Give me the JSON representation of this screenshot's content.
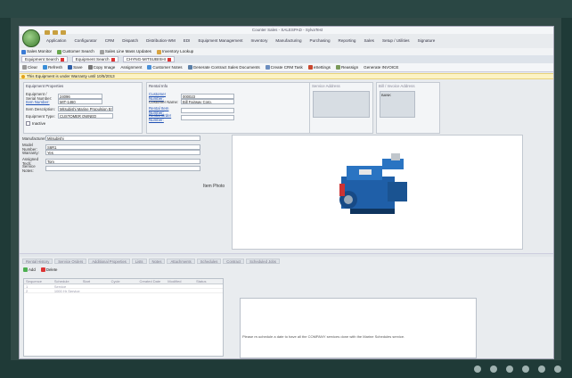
{
  "window": {
    "title": "Counter Sales - SALESPAD - SylvaTest"
  },
  "menu": [
    "Application",
    "Configurator",
    "CRM",
    "Dispatch",
    "Distribution-WM",
    "EDI",
    "Equipment Management",
    "Inventory",
    "Manufacturing",
    "Purchasing",
    "Reporting",
    "Sales",
    "Setup / Utilities",
    "Signature"
  ],
  "toolbar1": [
    "Sales Monitor",
    "Customer Search",
    "Sales Line Mass Updates",
    "Inventory Lookup"
  ],
  "doc_tabs": [
    "Equipment Search",
    "Equipment Search",
    "CHYNG-MITSUBISHI"
  ],
  "toolbar3": [
    "Clear",
    "Refresh",
    "Save",
    "Copy Image",
    "Assignment",
    "Customer Notes",
    "Generate Contract Sales Documents",
    "Create CRM Task",
    "eSettings",
    "Reassign",
    "Generate INVOICE"
  ],
  "warning": "This Equipment is under Warranty until 10/5/2013",
  "equipment_properties": {
    "title": "Equipment Properties",
    "fields": [
      {
        "label": "Equipment / Serial Number:",
        "value": "24096"
      },
      {
        "label": "Item Number:",
        "value": "MIT-1460"
      },
      {
        "label": "Item Description:",
        "value": "Mitsubishi Marine Propulsion Engine"
      },
      {
        "label": "Equipment Type:",
        "value": "CUSTOMER OWNED"
      }
    ],
    "inactive_label": "Inactive"
  },
  "rental_info": {
    "title": "Rental Info",
    "fields": [
      {
        "label": "Customer Number:",
        "value": "000023"
      },
      {
        "label": "Customer Name:",
        "value": "Bill Fairway Corp."
      },
      {
        "label": "Rental Item Number:",
        "value": ""
      },
      {
        "label": "Rental Order Number:",
        "value": ""
      }
    ]
  },
  "address": {
    "left_title": "Service Address",
    "right_title": "Bill / Invoice Address",
    "right_value": "BANK"
  },
  "specs": [
    {
      "label": "Manufacturer:",
      "value": "Mitsubishi"
    },
    {
      "label": "Model Number:",
      "value": "S6R1"
    },
    {
      "label": "Warranty:",
      "value": "Yes"
    },
    {
      "label": "Assigned Tech:",
      "value": "Tom"
    },
    {
      "label": "Service Notes:",
      "value": ""
    }
  ],
  "item_photo_label": "Item Photo",
  "lower_tabs": [
    "Rental History",
    "Service Orders",
    "Additional Properties",
    "Lists",
    "Notes",
    "Attachments",
    "Schedules",
    "Contract",
    "Scheduled Jobs"
  ],
  "lower_buttons": [
    "Add",
    "Delete"
  ],
  "grid_columns": [
    "Sequence",
    "Schedule",
    "Start",
    "Cycle",
    "Created Date",
    "Modified",
    "Status"
  ],
  "grid_rows": [
    [
      "1",
      "Service",
      "",
      "",
      "",
      "",
      ""
    ],
    [
      "2",
      "1000 Hr Service",
      "",
      "",
      "",
      "",
      ""
    ]
  ],
  "notes_text": "Please re-schedule a date to have all the COMPANY services done with the Marine Schedules service.",
  "colors": {
    "accent": "#1d4fb3",
    "warning_bg": "#fcf3c4",
    "frame": "#1f3a37"
  }
}
